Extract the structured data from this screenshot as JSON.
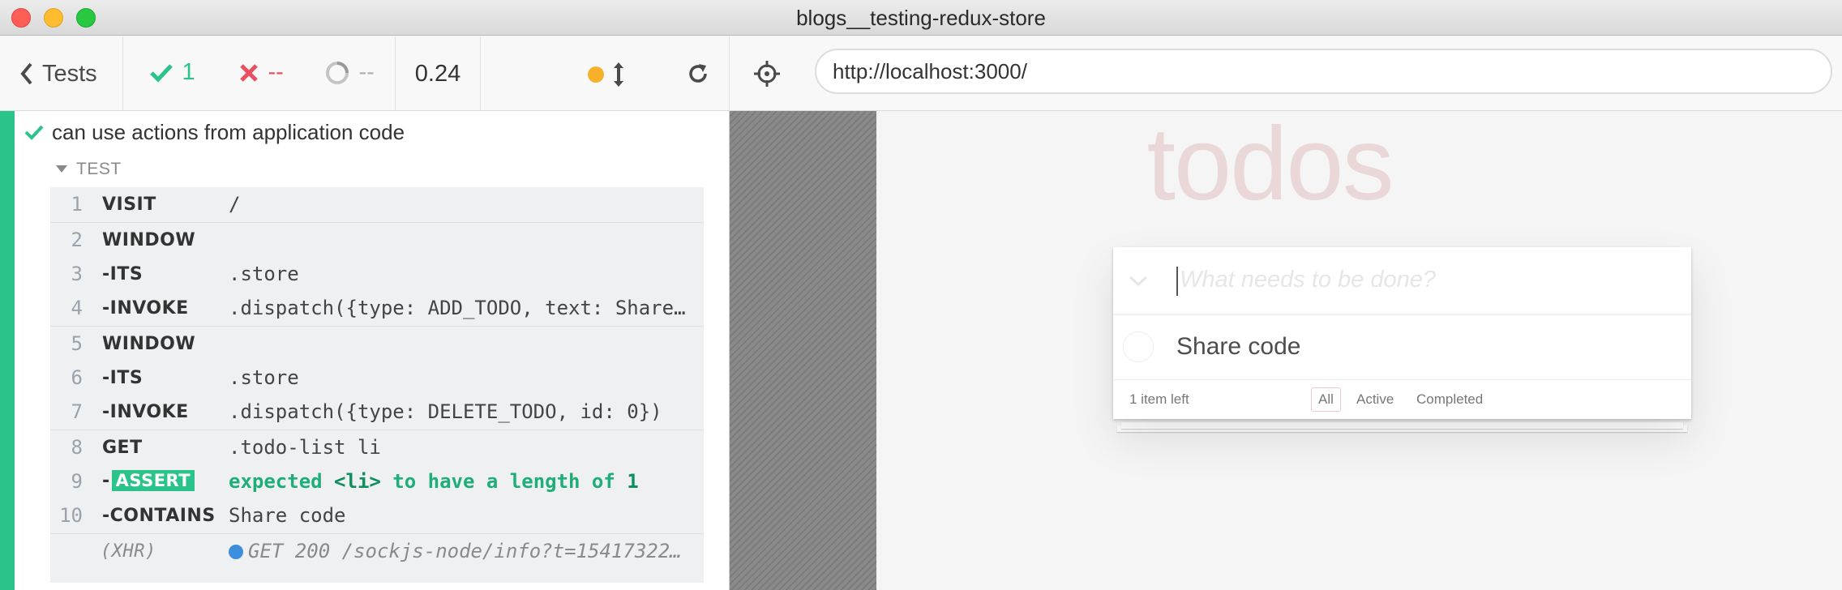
{
  "window": {
    "title": "blogs__testing-redux-store"
  },
  "header": {
    "back_label": "Tests",
    "passed_count": "1",
    "failed_count": "--",
    "pending_count": "--",
    "duration": "0.24",
    "url": "http://localhost:3000/"
  },
  "colors": {
    "pass": "#2ac48a",
    "fail": "#e94f5f",
    "running": "#f6b02a",
    "xhr_dot": "#3e8ede"
  },
  "reporter": {
    "test_title": "can use actions from application code",
    "section_label": "TEST",
    "commands": [
      {
        "num": "1",
        "name": "VISIT",
        "message": "/"
      },
      {
        "num": "2",
        "name": "WINDOW",
        "message": ""
      },
      {
        "num": "3",
        "name": "-ITS",
        "message": ".store"
      },
      {
        "num": "4",
        "name": "-INVOKE",
        "message": ".dispatch({type: ADD_TODO, text: Share…"
      },
      {
        "num": "5",
        "name": "WINDOW",
        "message": ""
      },
      {
        "num": "6",
        "name": "-ITS",
        "message": ".store"
      },
      {
        "num": "7",
        "name": "-INVOKE",
        "message": ".dispatch({type: DELETE_TODO, id: 0})"
      },
      {
        "num": "8",
        "name": "GET",
        "message": ".todo-list li"
      },
      {
        "num": "9",
        "name": "ASSERT",
        "message_parts": [
          "expected",
          "<li>",
          "to have a length of",
          "1"
        ]
      },
      {
        "num": "10",
        "name": "-CONTAINS",
        "message": "Share code"
      },
      {
        "num": "",
        "name": "(XHR)",
        "message": "GET 200 /sockjs-node/info?t=154173225…"
      }
    ]
  },
  "app": {
    "heading": "todos",
    "new_todo_placeholder": "What needs to be done?",
    "todo_text": "Share code",
    "items_left": "1 item left",
    "filters": [
      "All",
      "Active",
      "Completed"
    ]
  }
}
